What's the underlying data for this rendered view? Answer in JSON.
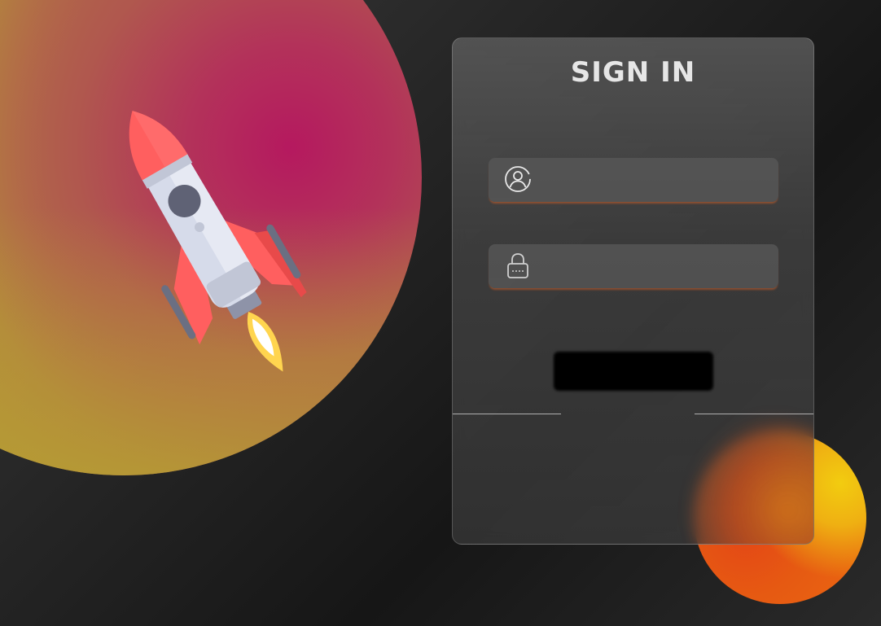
{
  "login": {
    "title": "SIGN IN",
    "username_value": "",
    "password_value": "",
    "submit_label": ""
  },
  "icons": {
    "user": "user-circle-icon",
    "password": "lock-icon",
    "hero": "rocket-illustration"
  },
  "colors": {
    "background": "#1c1c1c",
    "card": "#4a4a4a",
    "title": "#e6e6e6",
    "field_glow": "#d66028",
    "button": "#000000",
    "rocket_red": "#ff5f5f",
    "rocket_body": "#d6dbea",
    "orb_orange": "#e65a12",
    "orb_yellow": "#f2cc10"
  }
}
